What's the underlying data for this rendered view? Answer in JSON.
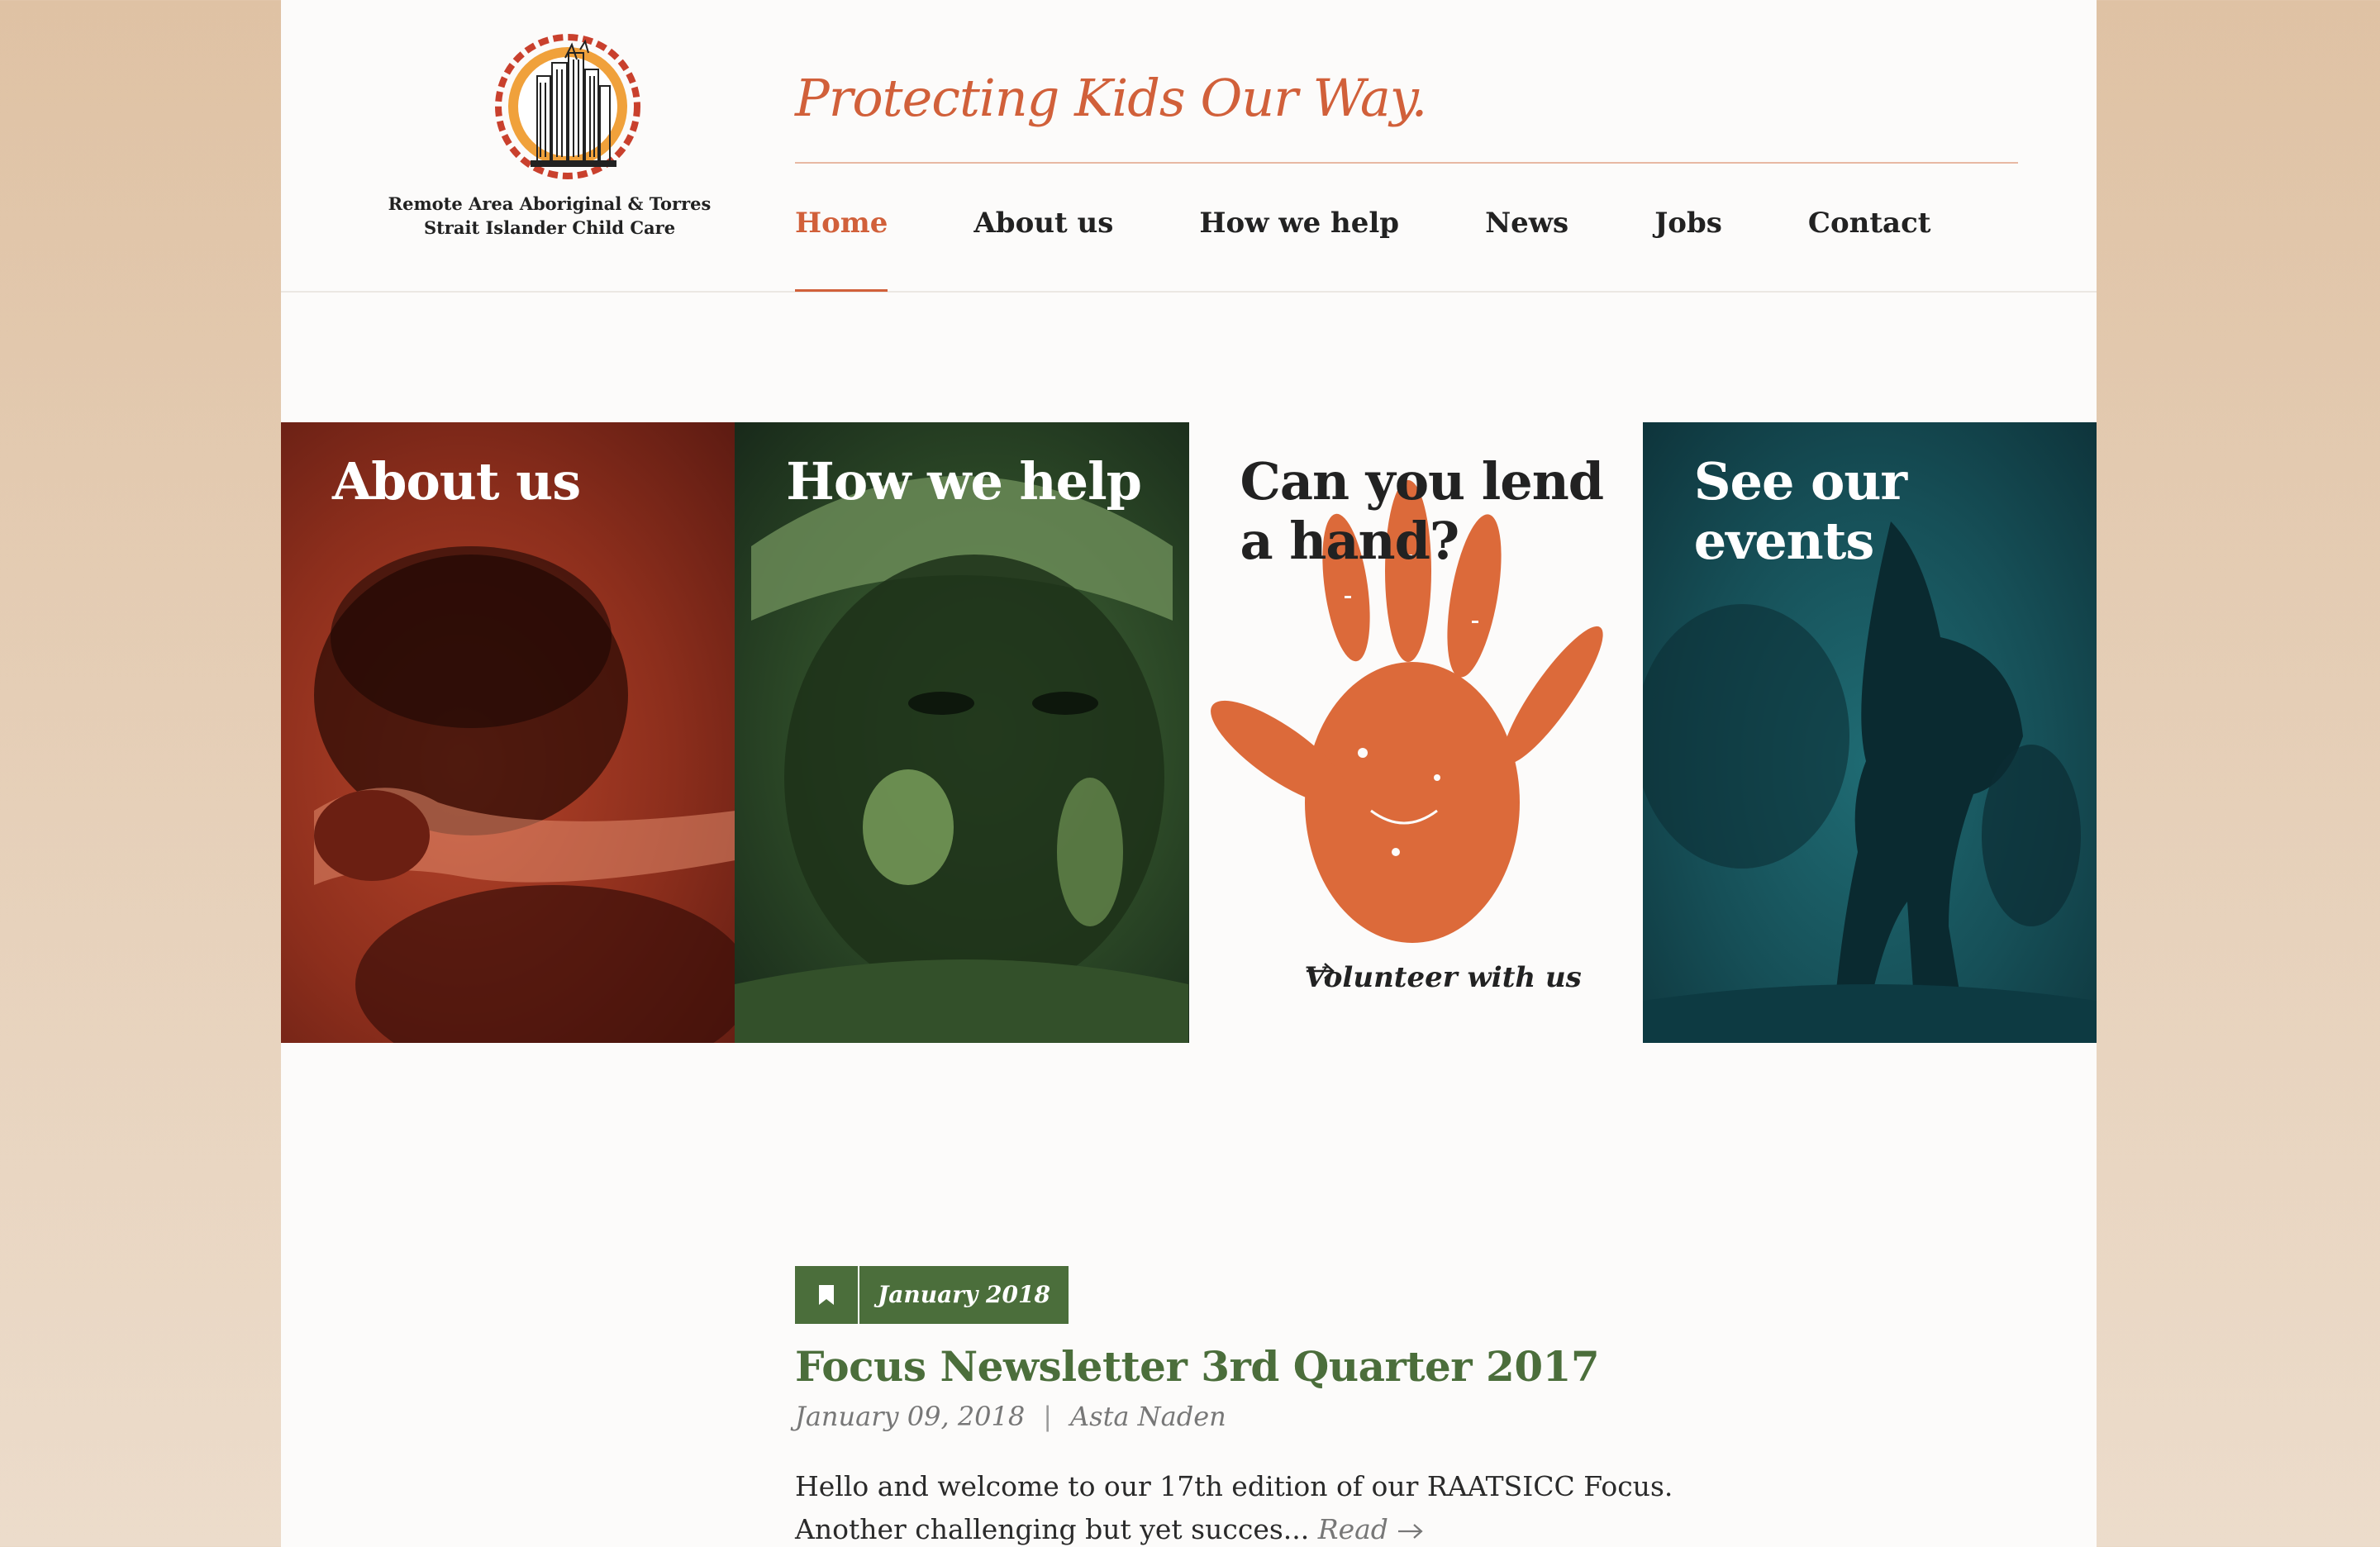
{
  "header": {
    "logo_text": "Remote Area Aboriginal & Torres Strait Islander Child Care",
    "tagline": "Protecting Kids Our Way."
  },
  "nav": {
    "items": [
      {
        "label": "Home",
        "active": true
      },
      {
        "label": "About us"
      },
      {
        "label": "How we help"
      },
      {
        "label": "News"
      },
      {
        "label": "Jobs"
      },
      {
        "label": "Contact"
      }
    ]
  },
  "tiles": [
    {
      "title": "About us"
    },
    {
      "title": "How we help"
    },
    {
      "title": "Can you lend a hand?",
      "link": "Volunteer with us"
    },
    {
      "title": "See our events"
    }
  ],
  "post": {
    "badge_date": "January 2018",
    "title": "Focus Newsletter 3rd Quarter 2017",
    "date": "January 09, 2018",
    "separator": "|",
    "author": "Asta Naden",
    "excerpt": "Hello and welcome to our 17th edition of our RAATSICC Focus. Another challenging but yet succes...",
    "read_label": "Read"
  },
  "colors": {
    "accent": "#d1603a",
    "green": "#4b6e3b",
    "teal": "#164f57",
    "rust": "#8c2e1c"
  },
  "icons": [
    "bookmark-icon",
    "arrow-right-icon",
    "handprint-icon"
  ]
}
